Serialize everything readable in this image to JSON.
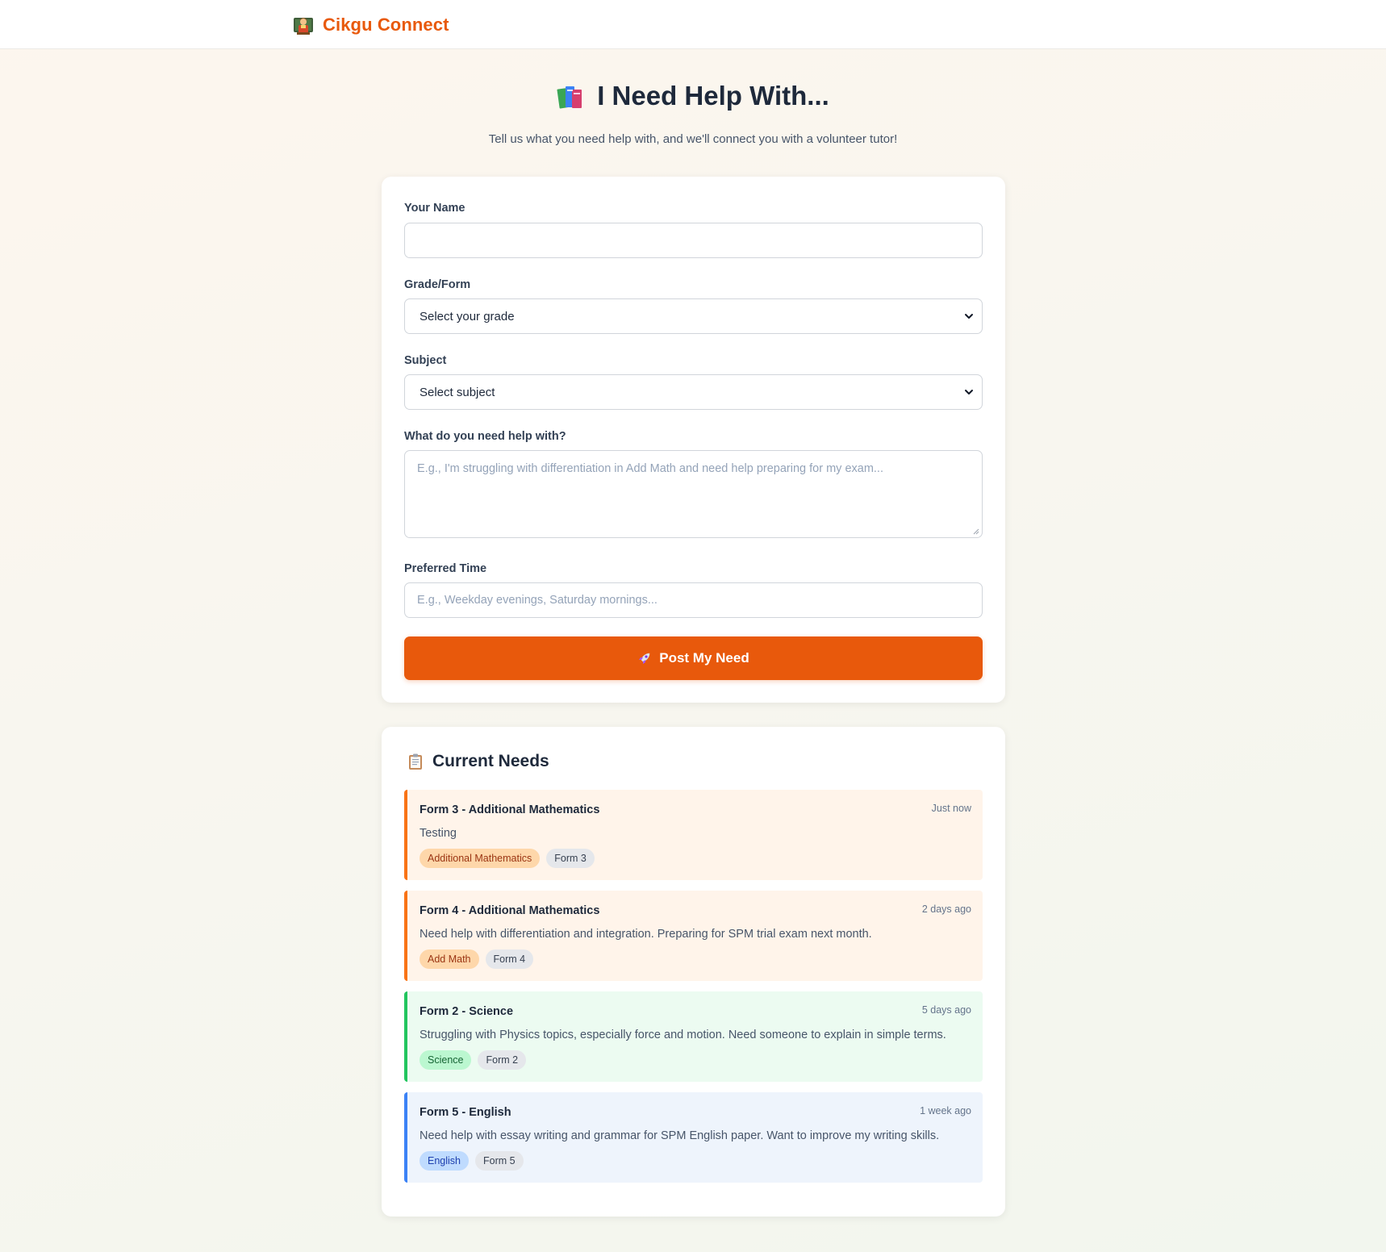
{
  "app": {
    "brand_name": "Cikgu Connect",
    "brand_icon": "teacher-icon",
    "accent_color": "#e8590c"
  },
  "hero": {
    "title": "I Need Help With...",
    "icon": "books-icon",
    "subtitle": "Tell us what you need help with, and we'll connect you with a volunteer tutor!"
  },
  "form": {
    "name_label": "Your Name",
    "name_value": "",
    "grade_label": "Grade/Form",
    "grade_selected": "Select your grade",
    "subject_label": "Subject",
    "subject_selected": "Select subject",
    "help_label": "What do you need help with?",
    "help_placeholder": "E.g., I'm struggling with differentiation in Add Math and need help preparing for my exam...",
    "time_label": "Preferred Time",
    "time_placeholder": "E.g., Weekday evenings, Saturday mornings...",
    "submit_label": "Post My Need",
    "submit_icon": "rocket-icon"
  },
  "needs": {
    "title": "Current Needs",
    "icon": "clipboard-icon",
    "items": [
      {
        "title": "Form 3 - Additional Mathematics",
        "time": "Just now",
        "description": "Testing",
        "subject_tag": "Additional Mathematics",
        "grade_tag": "Form 3",
        "color": "#f97316"
      },
      {
        "title": "Form 4 - Additional Mathematics",
        "time": "2 days ago",
        "description": "Need help with differentiation and integration. Preparing for SPM trial exam next month.",
        "subject_tag": "Add Math",
        "grade_tag": "Form 4",
        "color": "#f97316"
      },
      {
        "title": "Form 2 - Science",
        "time": "5 days ago",
        "description": "Struggling with Physics topics, especially force and motion. Need someone to explain in simple terms.",
        "subject_tag": "Science",
        "grade_tag": "Form 2",
        "color": "#22c55e"
      },
      {
        "title": "Form 5 - English",
        "time": "1 week ago",
        "description": "Need help with essay writing and grammar for SPM English paper. Want to improve my writing skills.",
        "subject_tag": "English",
        "grade_tag": "Form 5",
        "color": "#3b82f6"
      }
    ]
  }
}
